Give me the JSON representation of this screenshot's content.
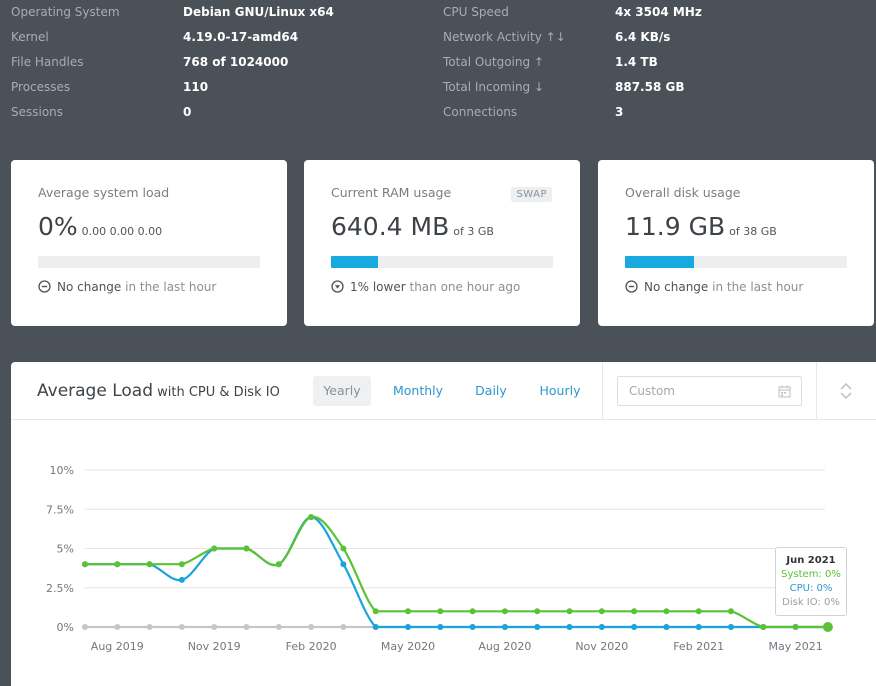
{
  "sysinfo": {
    "left": [
      {
        "label": "Operating System",
        "value": "Debian GNU/Linux x64"
      },
      {
        "label": "Kernel",
        "value": "4.19.0-17-amd64"
      },
      {
        "label": "File Handles",
        "value": "768 of 1024000"
      },
      {
        "label": "Processes",
        "value": "110"
      },
      {
        "label": "Sessions",
        "value": "0"
      }
    ],
    "right": [
      {
        "label": "CPU Speed",
        "value": "4x 3504 MHz"
      },
      {
        "label": "Network Activity ↑↓",
        "value": "6.4 KB/s"
      },
      {
        "label": "Total Outgoing ↑",
        "value": "1.4 TB"
      },
      {
        "label": "Total Incoming ↓",
        "value": "887.58 GB"
      },
      {
        "label": "Connections",
        "value": "3"
      }
    ]
  },
  "cards": {
    "load": {
      "title": "Average system load",
      "value": "0%",
      "detail": "0.00 0.00 0.00",
      "bar_fraction": 0,
      "foot_main": "No change",
      "foot_muted": " in the last hour",
      "foot_icon": "minus-circle-icon"
    },
    "ram": {
      "title": "Current RAM usage",
      "value": "640.4 MB",
      "detail": "of 3 GB",
      "bar_fraction": 0.21,
      "badge": "SWAP",
      "foot_main": "1% lower",
      "foot_muted": " than one hour ago",
      "foot_icon": "arrow-down-circle-icon"
    },
    "disk": {
      "title": "Overall disk usage",
      "value": "11.9 GB",
      "detail": "of 38 GB",
      "bar_fraction": 0.313,
      "foot_main": "No change",
      "foot_muted": " in the last hour",
      "foot_icon": "minus-circle-icon"
    }
  },
  "panel": {
    "title": "Average Load",
    "subtitle": " with CPU & Disk IO",
    "tabs": [
      "Yearly",
      "Monthly",
      "Daily",
      "Hourly"
    ],
    "active_tab": "Yearly",
    "custom_placeholder": "Custom"
  },
  "colors": {
    "system": "#5bc236",
    "cpu": "#1ba3dd",
    "disk": "#c4c7ca",
    "accent": "#18a9e1"
  },
  "tooltip": {
    "title": "Jun 2021",
    "system": "System: 0%",
    "cpu": "CPU: 0%",
    "disk": "Disk IO: 0%"
  },
  "chart_data": {
    "type": "line",
    "x": [
      "2019-07",
      "2019-08",
      "2019-09",
      "2019-10",
      "2019-11",
      "2019-12",
      "2020-01",
      "2020-02",
      "2020-03",
      "2020-04",
      "2020-05",
      "2020-06",
      "2020-07",
      "2020-08",
      "2020-09",
      "2020-10",
      "2020-11",
      "2020-12",
      "2021-01",
      "2021-02",
      "2021-03",
      "2021-04",
      "2021-05",
      "2021-06"
    ],
    "tick_labels": [
      {
        "x": "2019-08",
        "label": "Aug 2019"
      },
      {
        "x": "2019-11",
        "label": "Nov 2019"
      },
      {
        "x": "2020-02",
        "label": "Feb 2020"
      },
      {
        "x": "2020-05",
        "label": "May 2020"
      },
      {
        "x": "2020-08",
        "label": "Aug 2020"
      },
      {
        "x": "2020-11",
        "label": "Nov 2020"
      },
      {
        "x": "2021-02",
        "label": "Feb 2021"
      },
      {
        "x": "2021-05",
        "label": "May 2021"
      }
    ],
    "y_ticks": [
      "0%",
      "2.5%",
      "5%",
      "7.5%",
      "10%"
    ],
    "ylim": [
      0,
      10
    ],
    "grid": true,
    "series": [
      {
        "name": "Disk IO",
        "color": "#c4c7ca",
        "values": [
          0,
          0,
          0,
          0,
          0,
          0,
          0,
          0,
          0,
          0,
          0,
          0,
          0,
          0,
          0,
          0,
          0,
          0,
          0,
          0,
          0,
          0,
          0,
          0
        ]
      },
      {
        "name": "CPU",
        "color": "#1ba3dd",
        "values": [
          4,
          4,
          4,
          3,
          5,
          5,
          4,
          7,
          4,
          0,
          0,
          0,
          0,
          0,
          0,
          0,
          0,
          0,
          0,
          0,
          0,
          0,
          0,
          0
        ]
      },
      {
        "name": "System",
        "color": "#5bc236",
        "values": [
          4,
          4,
          4,
          4,
          5,
          5,
          4,
          7,
          5,
          1,
          1,
          1,
          1,
          1,
          1,
          1,
          1,
          1,
          1,
          1,
          1,
          0,
          0,
          0
        ]
      }
    ]
  }
}
